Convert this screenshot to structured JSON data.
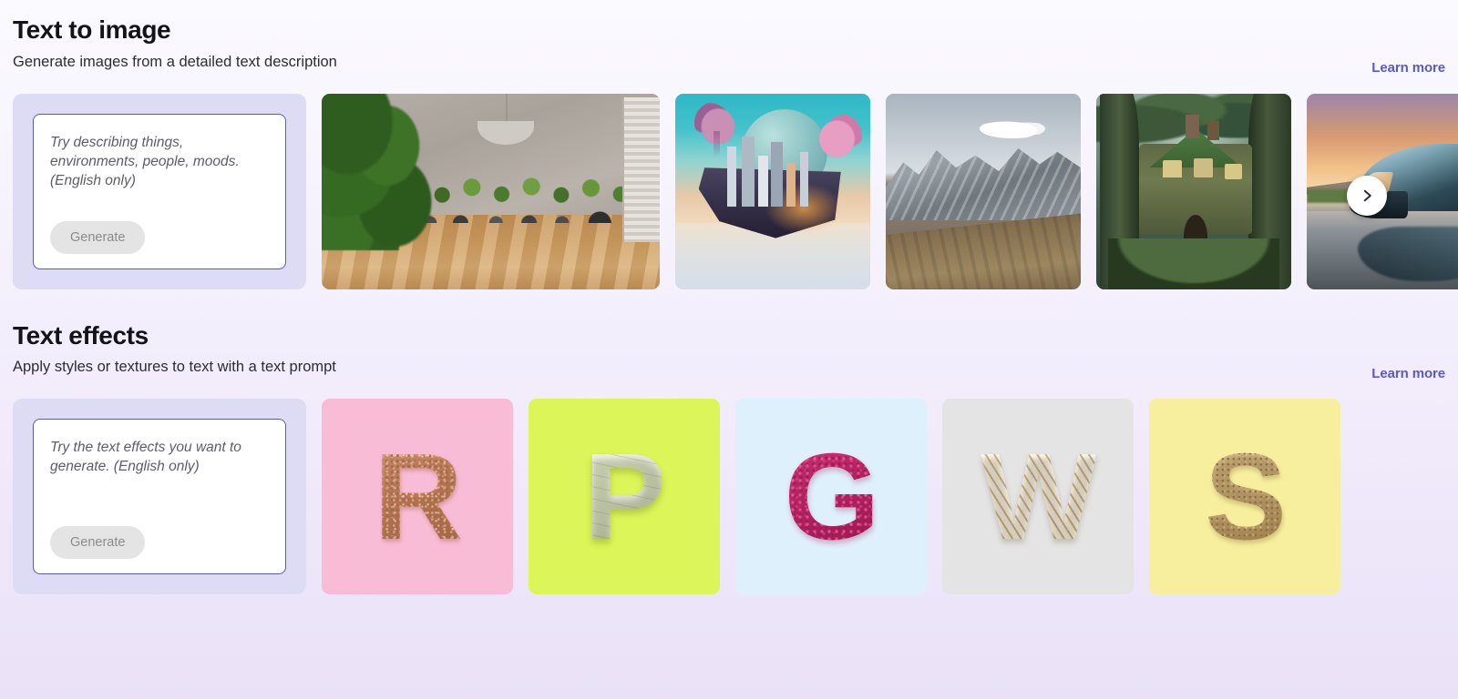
{
  "sections": [
    {
      "title": "Text to image",
      "subtitle": "Generate images from a detailed text description",
      "learn_more": "Learn more",
      "prompt": {
        "placeholder": "Try describing things, environments, people, moods. (English only)",
        "value": "",
        "generate_label": "Generate"
      },
      "thumbnails": [
        {
          "name": "interior-room-with-plants"
        },
        {
          "name": "floating-sci-fi-city"
        },
        {
          "name": "monochrome-mountains"
        },
        {
          "name": "mossy-treehouse"
        },
        {
          "name": "futuristic-car-at-sunset"
        }
      ],
      "next_label": "›"
    },
    {
      "title": "Text effects",
      "subtitle": "Apply styles or textures to text with a text prompt",
      "learn_more": "Learn more",
      "prompt": {
        "placeholder": "Try the text effects you want to generate. (English only)",
        "value": "",
        "generate_label": "Generate"
      },
      "effects": [
        {
          "letter": "R",
          "style": "rose-gold-glitter",
          "bg": "#f9bcd6"
        },
        {
          "letter": "P",
          "style": "puffy-quilted-white",
          "bg": "#dcf558"
        },
        {
          "letter": "G",
          "style": "magenta-beads",
          "bg": "#def0fc"
        },
        {
          "letter": "W",
          "style": "cream-wool-rope",
          "bg": "#e4e4e4"
        },
        {
          "letter": "S",
          "style": "sandy-cork",
          "bg": "#f7ef9e"
        }
      ]
    }
  ],
  "theme": {
    "page_bg_top": "#fbfaff",
    "page_bg_bottom": "#eae1f7",
    "link_color": "#5a5ac0",
    "prompt_card_bg": "#dedbf4",
    "prompt_border": "#5b5ba8",
    "generate_bg": "#e4e4e4",
    "generate_text": "#8b8b8b"
  }
}
